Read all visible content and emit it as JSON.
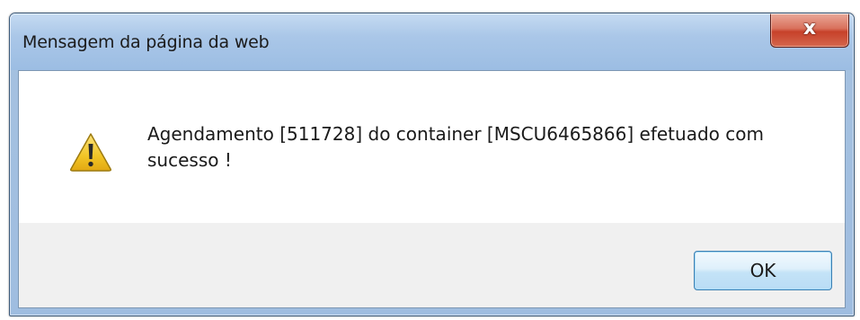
{
  "dialog": {
    "title": "Mensagem da página da web",
    "close_glyph": "x",
    "icon": "warning-icon",
    "message": "Agendamento [511728] do container [MSCU6465866] efetuado com sucesso !",
    "ok_label": "OK"
  },
  "colors": {
    "titlebar": "#a9c6e8",
    "close_button": "#c7412a",
    "ok_border": "#3c7fb1",
    "warning_fill": "#f2c526"
  }
}
